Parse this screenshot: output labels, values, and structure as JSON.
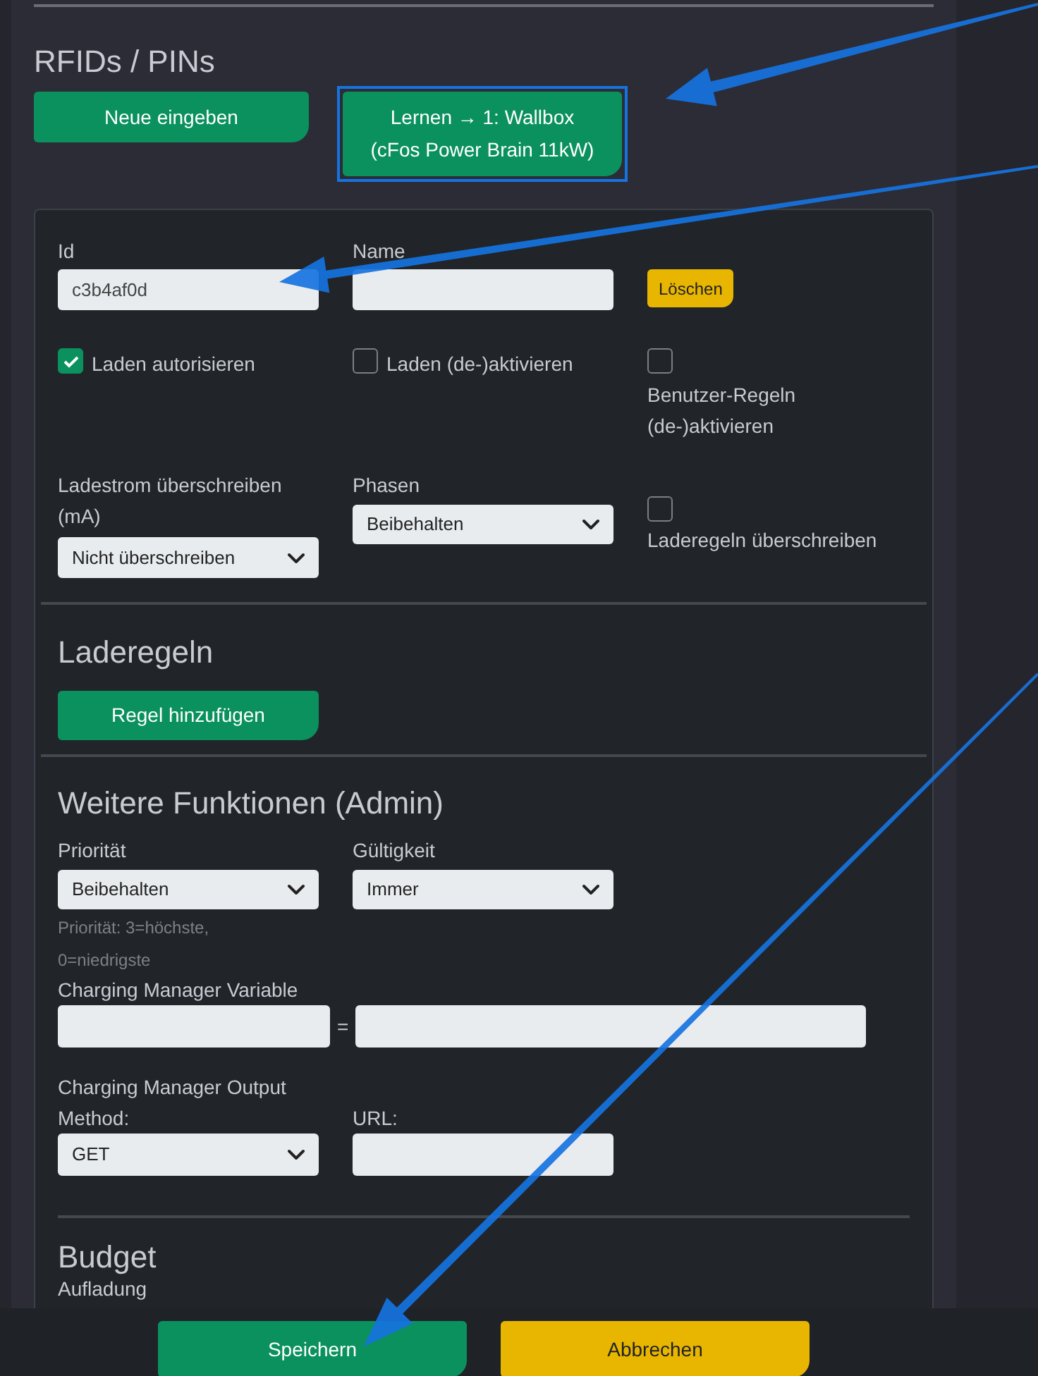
{
  "title": "RFIDs / PINs",
  "top_buttons": [
    {
      "lines": [
        "Neue eingeben"
      ],
      "highlighted": false
    },
    {
      "lines": [
        "Lernen → 1: Wallbox",
        "(cFos Power Brain 11kW)"
      ],
      "highlighted": true
    }
  ],
  "rfid": {
    "id": {
      "label": "Id",
      "value": "c3b4af0d"
    },
    "name": {
      "label": "Name"
    },
    "delete_button": "Löschen",
    "checkboxes": [
      {
        "label": "Laden autorisieren",
        "checked": true,
        "stacked": false
      },
      {
        "label": "Laden (de-)aktivieren",
        "checked": false,
        "stacked": false
      },
      {
        "label": "Benutzer-Regeln (de-)aktivieren",
        "checked": false,
        "stacked": true
      }
    ],
    "charge_current": {
      "label": "Ladestrom überschreiben (mA)",
      "value": "Nicht überschreiben"
    },
    "phases": {
      "label": "Phasen",
      "value": "Beibehalten"
    },
    "override_rules": {
      "label": "Laderegeln überschreiben",
      "checked": false
    }
  },
  "charging_rules": {
    "heading": "Laderegeln",
    "button": "Regel hinzufügen"
  },
  "admin": {
    "heading": "Weitere Funktionen (Admin)",
    "priority": {
      "label": "Priorität",
      "value": "Beibehalten",
      "hint": "Priorität: 3=höchste, 0=niedrigste"
    },
    "validity": {
      "label": "Gültigkeit",
      "value": "Immer"
    },
    "variable": {
      "label": "Charging Manager Variable",
      "separator": "="
    },
    "output": {
      "label": "Charging Manager Output",
      "method_label": "Method:",
      "method": "GET",
      "url_label": "URL:"
    }
  },
  "budget": {
    "heading": "Budget",
    "label": "Aufladung"
  },
  "footer": [
    {
      "label": "Speichern",
      "kind": "primary"
    },
    {
      "label": "Abbrechen",
      "kind": "warning"
    }
  ]
}
